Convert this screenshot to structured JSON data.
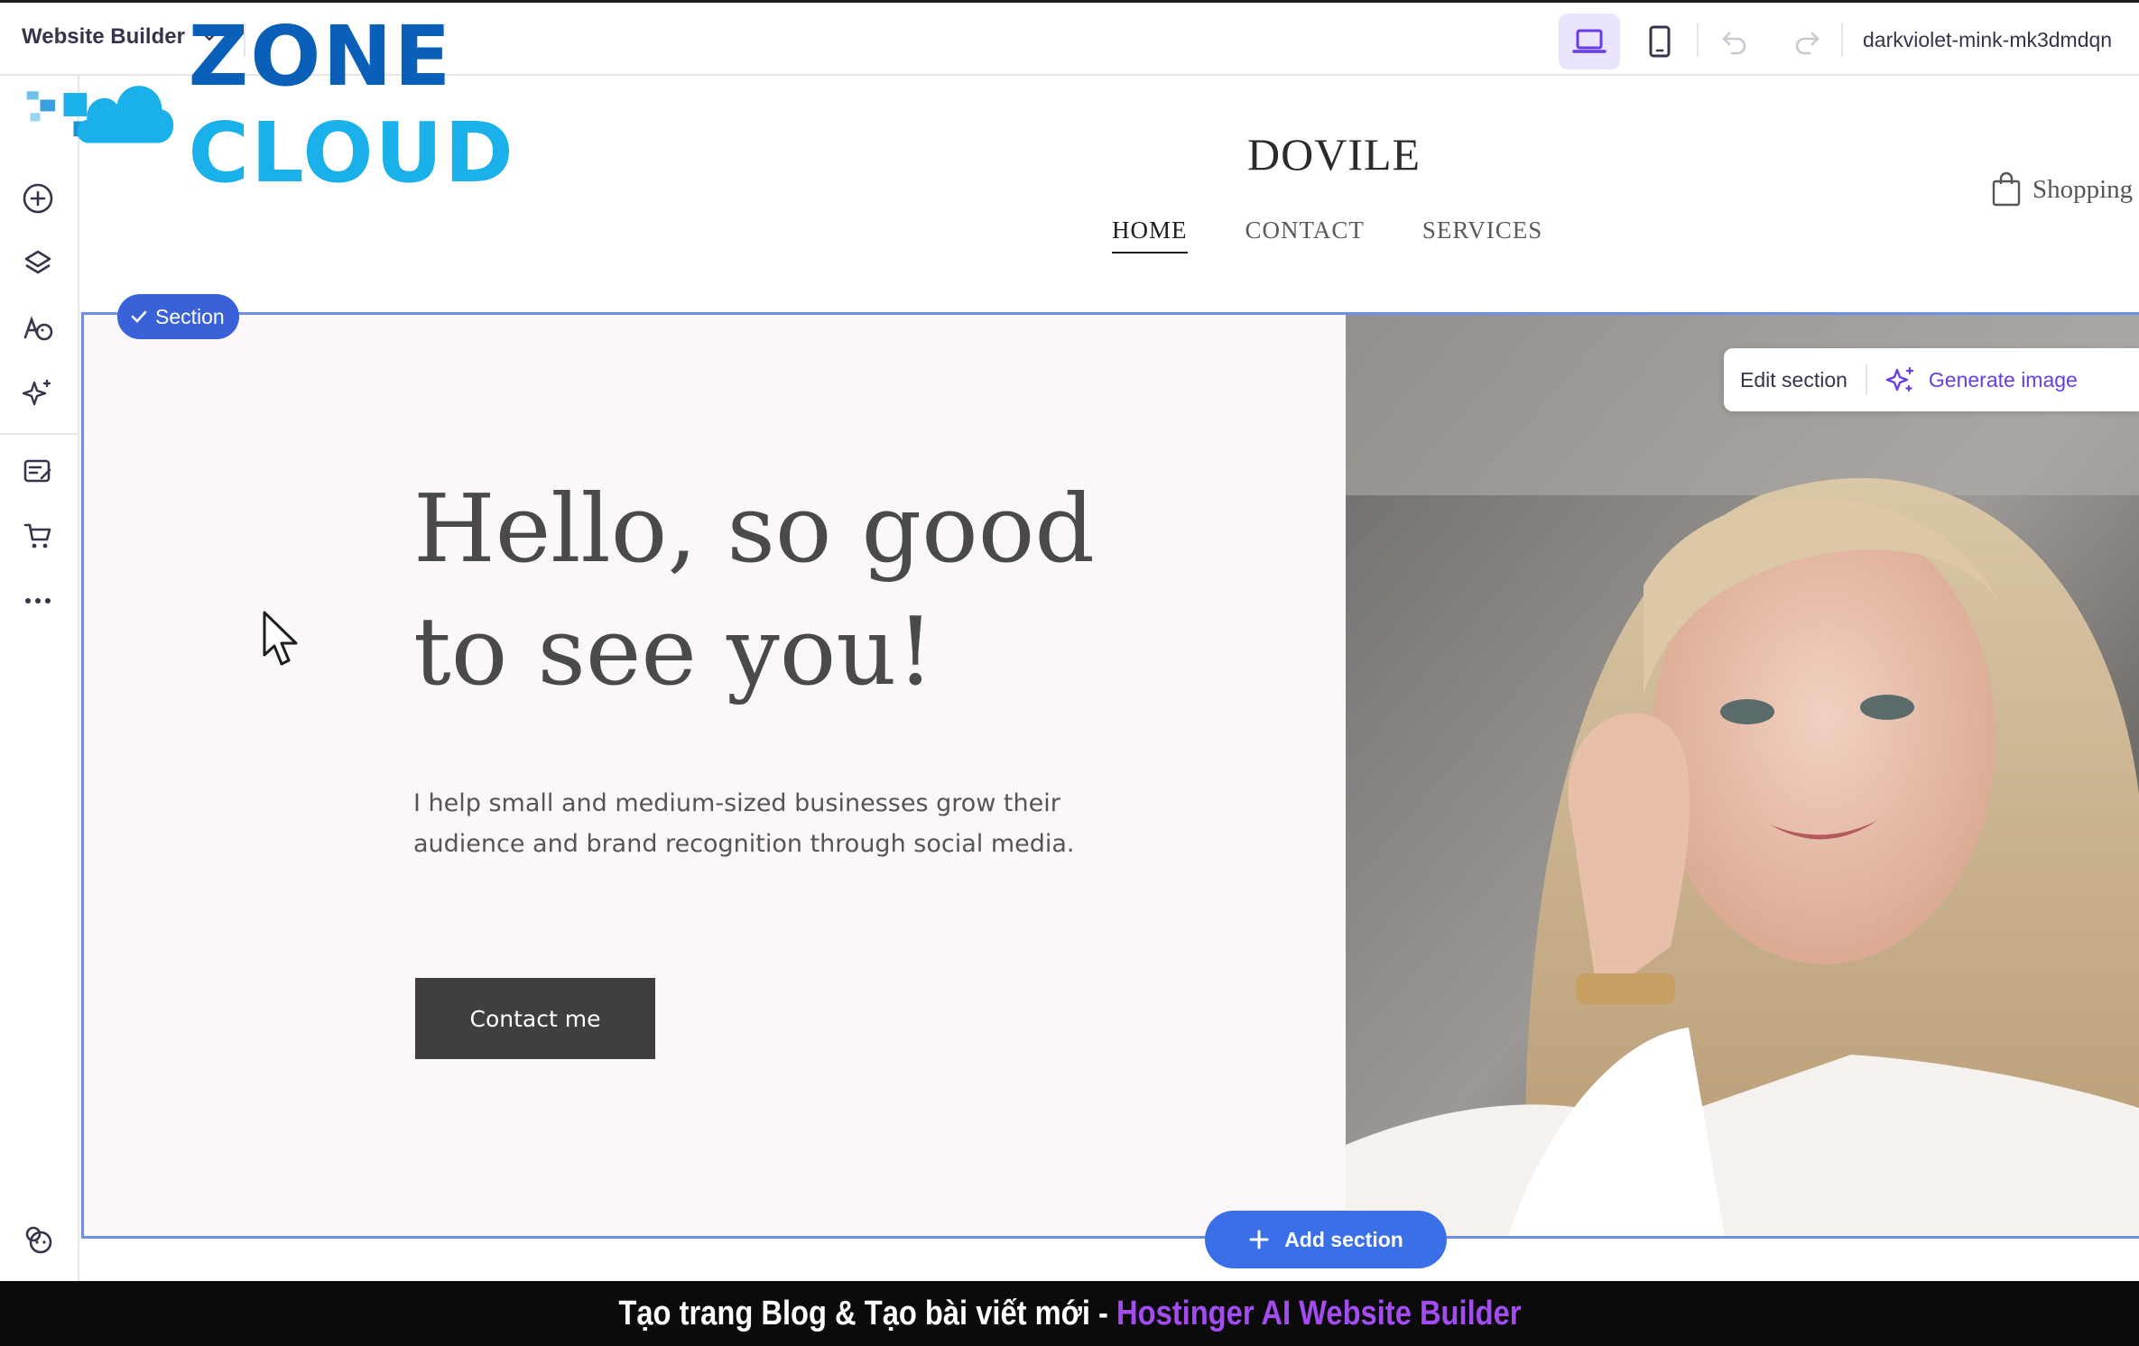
{
  "topbar": {
    "app_title": "Website Builder",
    "domain": "darkvioletmink-mk3dmdqn",
    "domain_display": "darkviolet-mink-mk3dmdqn"
  },
  "logo": {
    "word1": "ZONE",
    "word2": "CLOUD"
  },
  "site": {
    "name": "DOVILE",
    "nav": [
      {
        "label": "HOME",
        "active": true
      },
      {
        "label": "CONTACT",
        "active": false
      },
      {
        "label": "SERVICES",
        "active": false
      }
    ],
    "cart_label": "Shopping"
  },
  "section": {
    "badge": "Section",
    "title": "Hello, so good to see you!",
    "description": "I help small and medium-sized businesses grow their audience and brand recognition through social media.",
    "button_label": "Contact me",
    "edit_label": "Edit section",
    "generate_label": "Generate image",
    "add_label": "Add section"
  },
  "caption": {
    "prefix": "Tạo trang Blog & Tạo bài viết mới - ",
    "accent": "Hostinger AI Website Builder"
  },
  "colors": {
    "accent": "#673de6",
    "selection": "#3a62d8",
    "add_button": "#3a6fe8",
    "hero_bg": "#fcf7fa"
  }
}
